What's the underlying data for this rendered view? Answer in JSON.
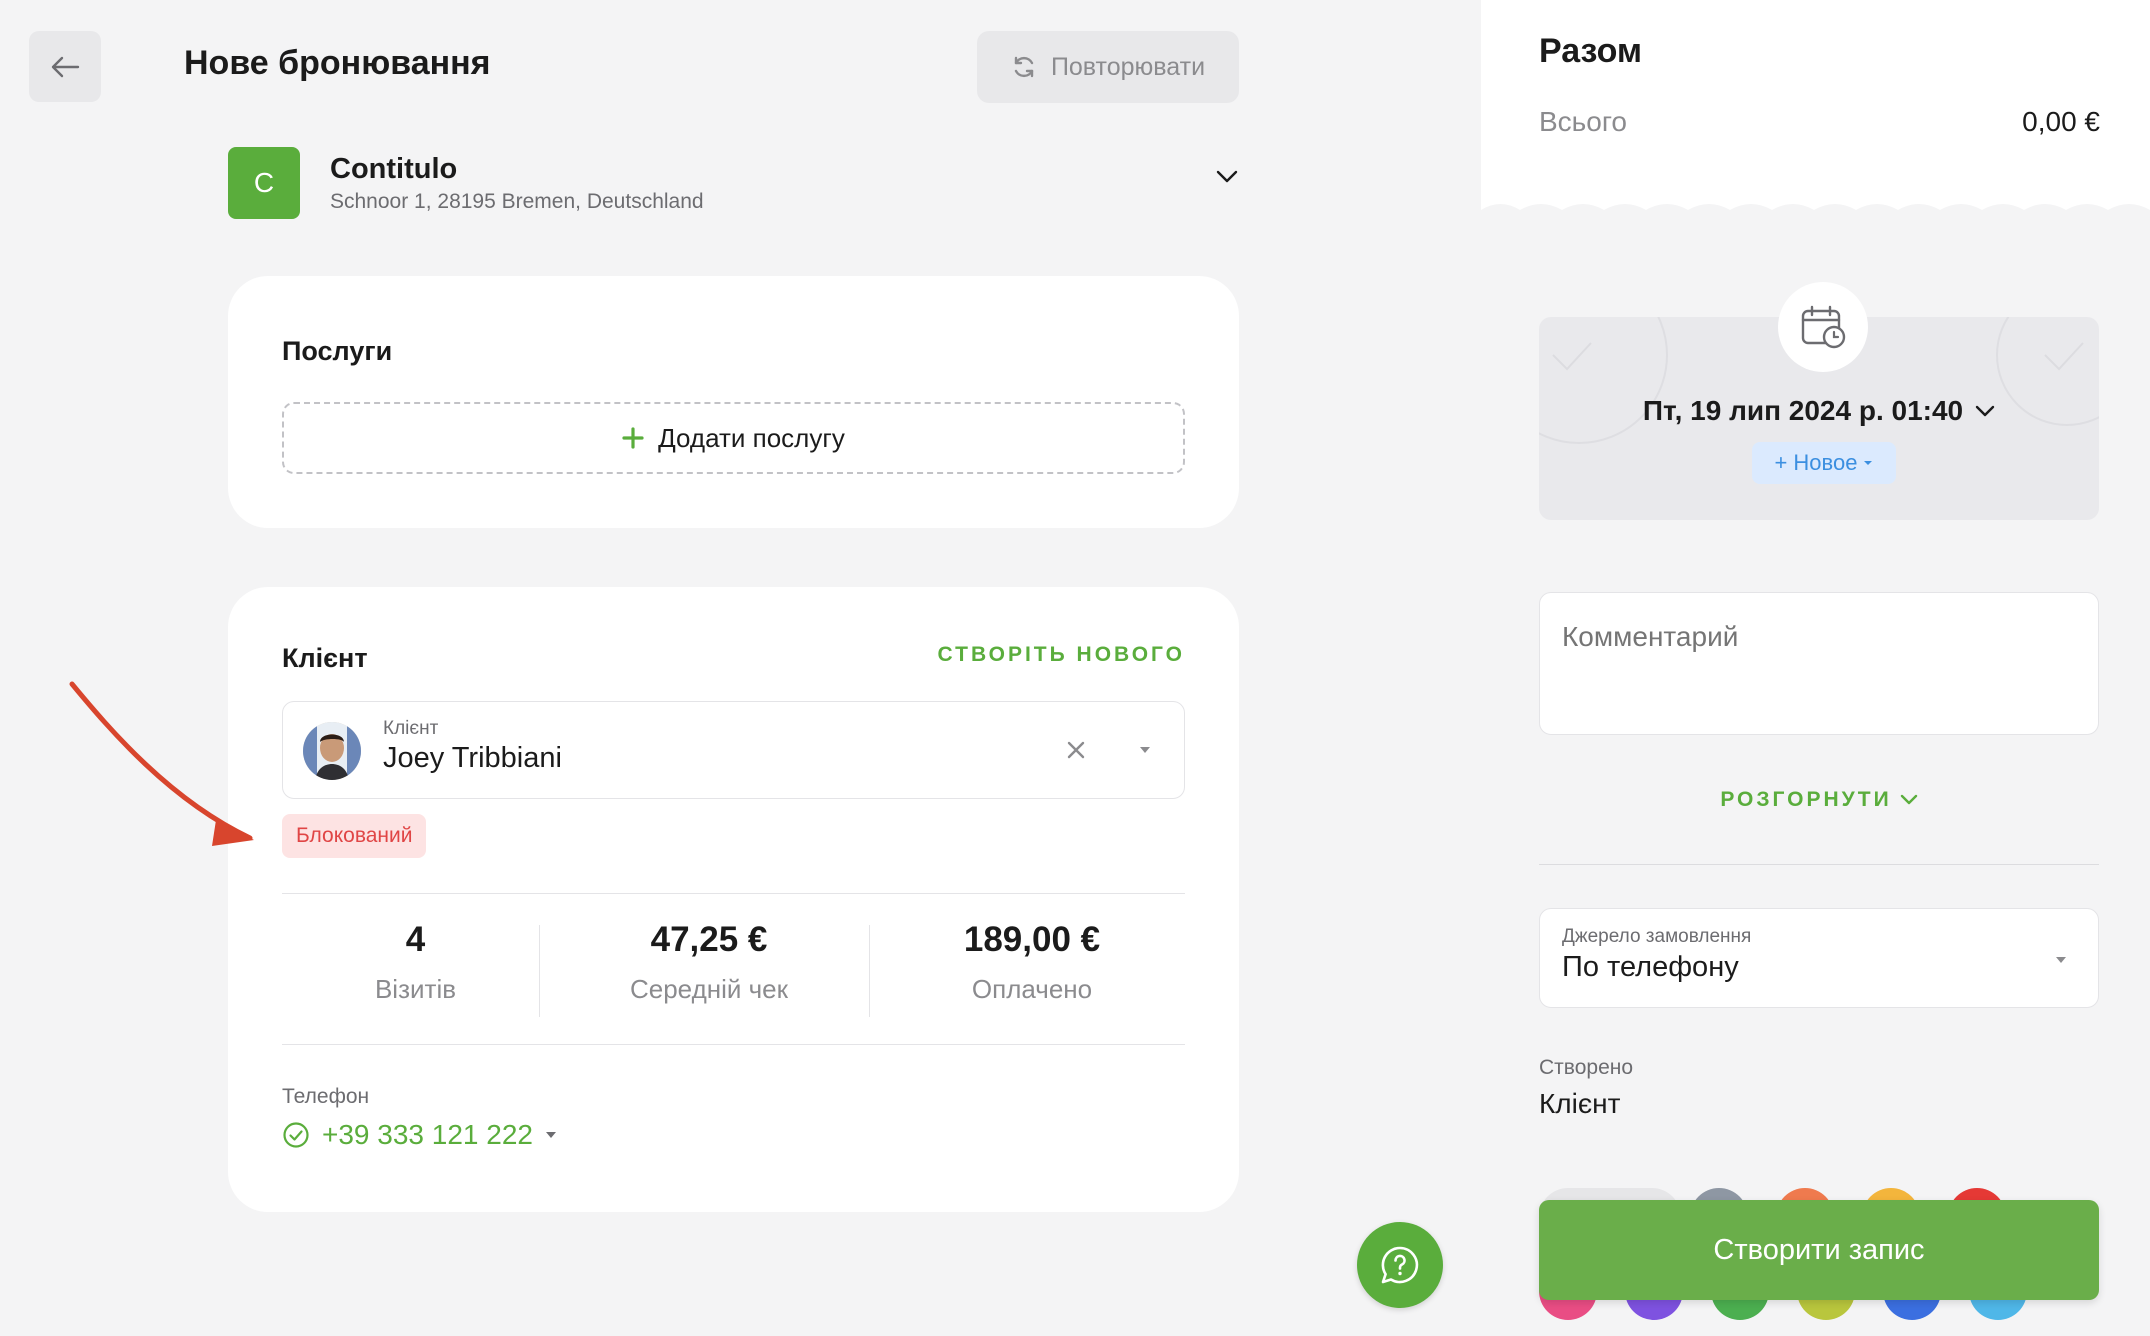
{
  "header": {
    "title": "Нове бронювання",
    "repeat_label": "Повторювати",
    "back_icon": "arrow-left-icon",
    "repeat_icon": "refresh-icon"
  },
  "location": {
    "initial": "C",
    "name": "Contitulo",
    "address": "Schnoor 1, 28195 Bremen, Deutschland",
    "color": "#5aad3c"
  },
  "services": {
    "title": "Послуги",
    "add_label": "Додати послугу"
  },
  "client": {
    "title": "Клієнт",
    "create_new_label": "СТВОРІТЬ НОВОГО",
    "field_label": "Клієнт",
    "name": "Joey Tribbiani",
    "status_badge": "Блокований",
    "stats": [
      {
        "value": "4",
        "label": "Візитів"
      },
      {
        "value": "47,25 €",
        "label": "Середній чек"
      },
      {
        "value": "189,00 €",
        "label": "Оплачено"
      }
    ],
    "phone_label": "Телефон",
    "phone": "+39 333 121 222"
  },
  "summary": {
    "title": "Разом",
    "total_label": "Всього",
    "total_value": "0,00 €"
  },
  "datetime": {
    "value": "Пт, 19 лип 2024 р. 01:40",
    "status": "Новое"
  },
  "comment": {
    "placeholder": "Комментарий"
  },
  "expand_label": "РОЗГОРНУТИ",
  "order_source": {
    "label": "Джерело замовлення",
    "value": "По телефону"
  },
  "created": {
    "label": "Створено",
    "value": "Клієнт"
  },
  "create_button": "Створити запис",
  "colors": {
    "accent": "#5aad3c",
    "danger": "#e04545",
    "info": "#3b8fe0",
    "palette_top": [
      "#e6e6e8",
      "#8e97a3",
      "#ef7a4e",
      "#f3b53c",
      "#e53935"
    ],
    "palette_bottom": [
      "#e94d84",
      "#7e52e0",
      "#4caf50",
      "#b9c63d",
      "#3b6fe0",
      "#4fb7e8"
    ]
  }
}
